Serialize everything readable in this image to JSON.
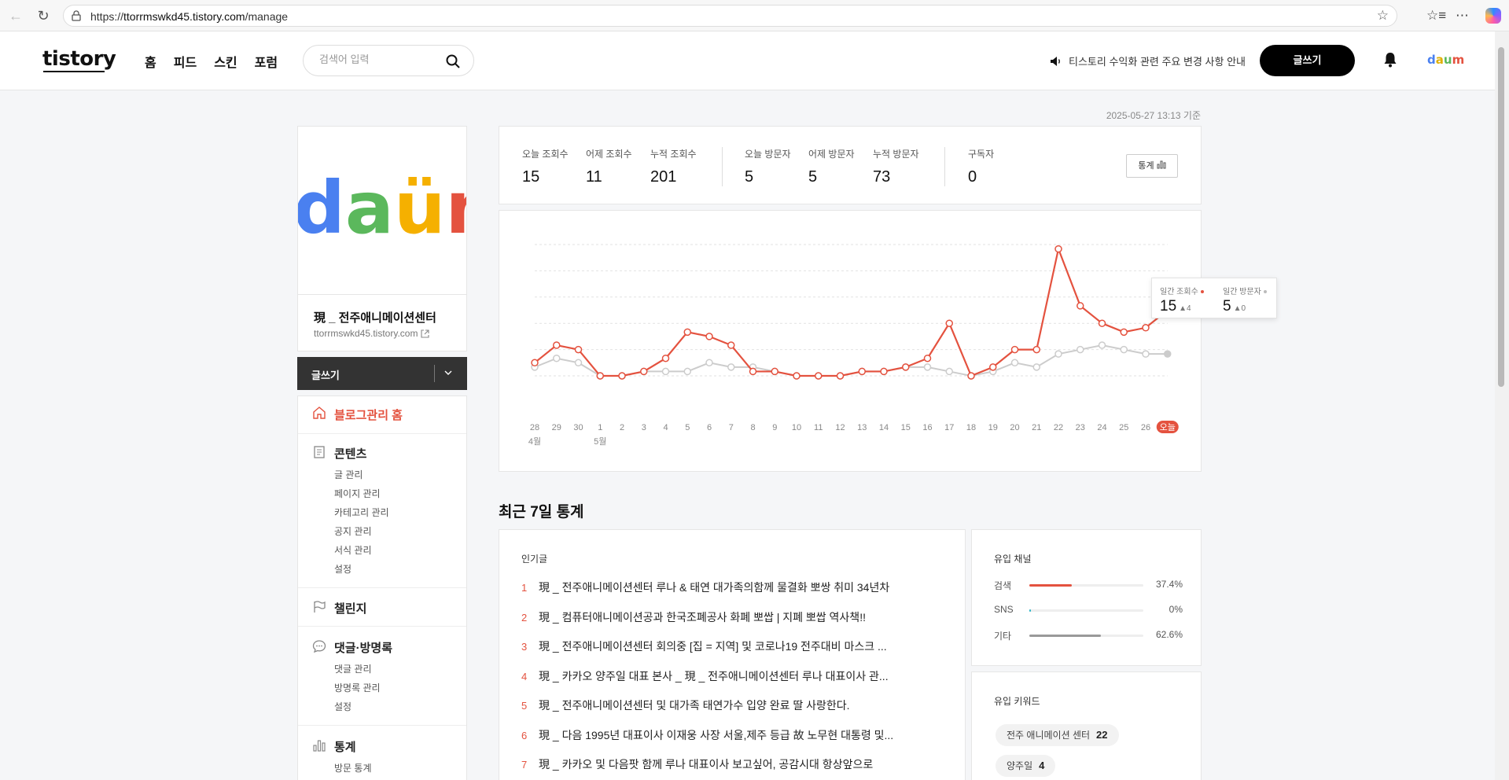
{
  "browser": {
    "url_prefix": "https://",
    "url_host": "ttorrmswkd45.tistory.com",
    "url_path": "/manage"
  },
  "header": {
    "logo": "tistory",
    "nav": [
      "홈",
      "피드",
      "스킨",
      "포럼"
    ],
    "search_placeholder": "검색어 입력",
    "notice": "티스토리 수익화 관련 주요 변경 사항 안내",
    "write_label": "글쓰기",
    "daum_label": "daum"
  },
  "timestamp": "2025-05-27 13:13 기준",
  "profile": {
    "image_text": "daüm",
    "blog_name": "現 _ 전주애니메이션센터",
    "blog_url": "ttorrmswkd45.tistory.com"
  },
  "sidebar": {
    "write_label": "글쓰기",
    "home_label": "블로그관리 홈",
    "groups": [
      {
        "title": "콘텐츠",
        "items": [
          "글 관리",
          "페이지 관리",
          "카테고리 관리",
          "공지 관리",
          "서식 관리",
          "설정"
        ]
      },
      {
        "title": "챌린지",
        "items": []
      },
      {
        "title": "댓글·방명록",
        "items": [
          "댓글 관리",
          "방명록 관리",
          "설정"
        ]
      },
      {
        "title": "통계",
        "items": [
          "방문 통계"
        ]
      }
    ]
  },
  "stats": {
    "items": [
      {
        "label": "오늘 조회수",
        "value": "15"
      },
      {
        "label": "어제 조회수",
        "value": "11"
      },
      {
        "label": "누적 조회수",
        "value": "201"
      },
      {
        "label": "오늘 방문자",
        "value": "5"
      },
      {
        "label": "어제 방문자",
        "value": "5"
      },
      {
        "label": "누적 방문자",
        "value": "73"
      },
      {
        "label": "구독자",
        "value": "0"
      }
    ],
    "button_label": "통계"
  },
  "chart_data": {
    "type": "line",
    "x": [
      "28",
      "29",
      "30",
      "1",
      "2",
      "3",
      "4",
      "5",
      "6",
      "7",
      "8",
      "9",
      "10",
      "11",
      "12",
      "13",
      "14",
      "15",
      "16",
      "17",
      "18",
      "19",
      "20",
      "21",
      "22",
      "23",
      "24",
      "25",
      "26",
      "오늘"
    ],
    "month_labels": [
      {
        "index": 0,
        "label": "4월"
      },
      {
        "index": 3,
        "label": "5월"
      }
    ],
    "series": [
      {
        "name": "일간 조회수",
        "color": "#e4523f",
        "values": [
          3,
          7,
          6,
          0,
          0,
          1,
          4,
          10,
          9,
          7,
          1,
          1,
          0,
          0,
          0,
          1,
          1,
          2,
          4,
          12,
          0,
          2,
          6,
          6,
          29,
          16,
          12,
          10,
          11,
          15
        ]
      },
      {
        "name": "일간 방문자",
        "color": "#cccccc",
        "values": [
          2,
          4,
          3,
          0,
          0,
          1,
          1,
          1,
          3,
          2,
          2,
          1,
          0,
          0,
          0,
          1,
          1,
          2,
          2,
          1,
          0,
          1,
          3,
          2,
          5,
          6,
          7,
          6,
          5,
          5
        ]
      }
    ],
    "ylim": [
      0,
      30
    ],
    "grid": true,
    "tooltip": {
      "views_label": "일간 조회수",
      "views_value": "15",
      "views_delta": "4",
      "visitors_label": "일간 방문자",
      "visitors_value": "5",
      "visitors_delta": "0"
    }
  },
  "recent": {
    "title": "최근 7일 통계",
    "popular_label": "인기글",
    "popular": [
      {
        "rank": "1",
        "title": "現 _ 전주애니메이션센터 루나 & 태연 대가족의함께 물결화 뽀쌍 취미 34년차"
      },
      {
        "rank": "2",
        "title": "現 _ 컴퓨터애니메이션공과 한국조폐공사 화폐 뽀쌉 | 지폐 뽀쌉 역사책!!"
      },
      {
        "rank": "3",
        "title": "現 _ 전주애니메이션센터 회의중 [집 = 지역] 및 코로나19 전주대비 마스크 ..."
      },
      {
        "rank": "4",
        "title": "現 _ 카카오 양주일 대표 본사 _ 現 _ 전주애니메이션센터 루나 대표이사 관..."
      },
      {
        "rank": "5",
        "title": "現 _ 전주애니메이션센터 및 대가족 태연가수 입양 완료 딸 사랑한다."
      },
      {
        "rank": "6",
        "title": "現 _ 다음 1995년 대표이사 이재웅 사장 서울,제주 등급 故 노무현 대통령 및..."
      },
      {
        "rank": "7",
        "title": "現 _ 카카오 및 다음팟 함께 루나 대표이사 보고싶어, 공감시대 항상앞으로"
      }
    ],
    "inflow_label": "유입 채널",
    "channels": [
      {
        "label": "검색",
        "value": "37.4%",
        "ratio": 0.374,
        "color": "#e4523f"
      },
      {
        "label": "SNS",
        "value": "0%",
        "ratio": 0.0,
        "color": "#2bb5c8"
      },
      {
        "label": "기타",
        "value": "62.6%",
        "ratio": 0.626,
        "color": "#999999"
      }
    ],
    "keywords_label": "유입 키워드",
    "keywords": [
      {
        "text": "전주 애니메이션 센터",
        "count": "22"
      },
      {
        "text": "양주일",
        "count": "4"
      }
    ]
  }
}
